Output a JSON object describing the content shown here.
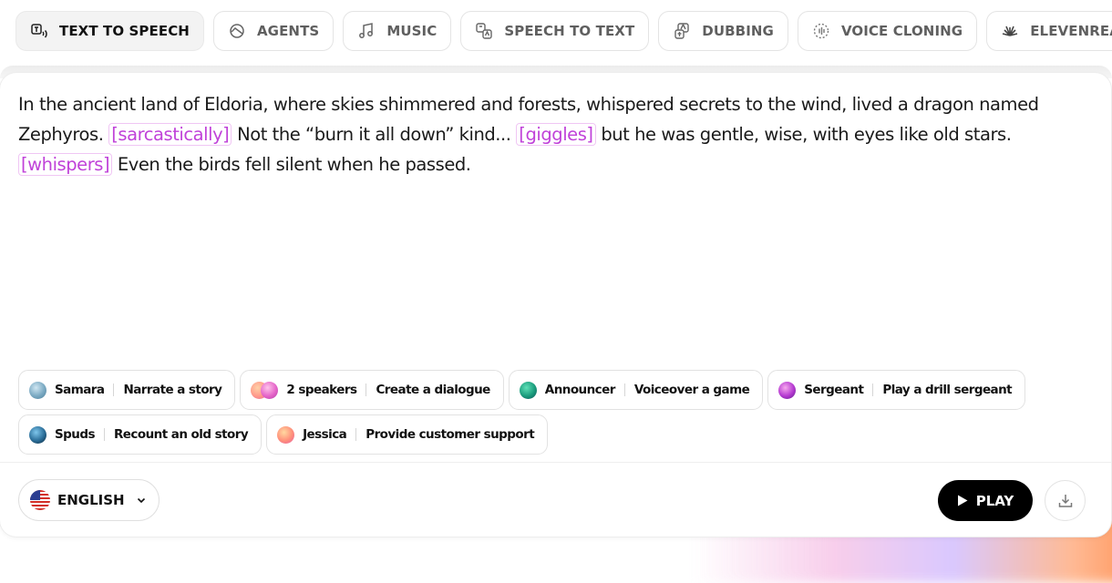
{
  "tabs": [
    {
      "label": "TEXT TO SPEECH",
      "icon": "text-to-speech-icon",
      "active": true
    },
    {
      "label": "AGENTS",
      "icon": "agents-icon"
    },
    {
      "label": "MUSIC",
      "icon": "music-icon"
    },
    {
      "label": "SPEECH TO TEXT",
      "icon": "speech-to-text-icon"
    },
    {
      "label": "DUBBING",
      "icon": "dubbing-icon"
    },
    {
      "label": "VOICE CLONING",
      "icon": "voice-cloning-icon"
    },
    {
      "label": "ELEVENREADER",
      "icon": "elevenreader-icon"
    }
  ],
  "story": {
    "p1": "In the ancient land of Eldoria, where skies shimmered and forests, whispered secrets to the wind, lived a dragon named Zephyros. ",
    "tag1": "[sarcastically]",
    "p2": " Not the “burn it all down” kind... ",
    "tag2": "[giggles]",
    "p3": " but he was gentle, wise, with eyes like old stars. ",
    "tag3": "[whispers]",
    "p4": " Even the birds fell silent when he passed."
  },
  "suggestions": [
    {
      "voice": "Samara",
      "action": "Narrate a story"
    },
    {
      "voice": "2 speakers",
      "action": "Create a dialogue"
    },
    {
      "voice": "Announcer",
      "action": "Voiceover a game"
    },
    {
      "voice": "Sergeant",
      "action": "Play a drill sergeant"
    },
    {
      "voice": "Spuds",
      "action": "Recount an old story"
    },
    {
      "voice": "Jessica",
      "action": "Provide customer support"
    }
  ],
  "language": {
    "label": "ENGLISH",
    "flag": "us-flag-icon"
  },
  "play_label": "PLAY",
  "colors": {
    "tag": "#c042d9",
    "play_bg": "#000000"
  }
}
